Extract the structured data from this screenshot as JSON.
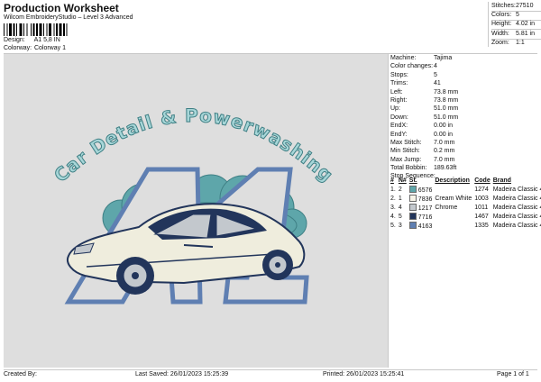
{
  "header": {
    "title": "Production Worksheet",
    "subtitle": "Wilcom EmbroideryStudio – Level 3 Advanced"
  },
  "design": {
    "label": "Design:",
    "value": "A1 5,8 IN"
  },
  "colorway": {
    "label": "Colorway:",
    "value": "Colorway 1"
  },
  "stats": [
    {
      "label": "Stitches:",
      "value": "27510"
    },
    {
      "label": "Colors:",
      "value": "5"
    },
    {
      "label": "Height:",
      "value": "4.02 in"
    },
    {
      "label": "Width:",
      "value": "5.81 in"
    },
    {
      "label": "Zoom:",
      "value": "1:1"
    }
  ],
  "machine_info": [
    {
      "label": "Machine:",
      "value": "Tajima"
    },
    {
      "label": "Color changes:",
      "value": "4"
    },
    {
      "label": "Stops:",
      "value": "5"
    },
    {
      "label": "Trims:",
      "value": "41"
    },
    {
      "label": "Left:",
      "value": "73.8 mm"
    },
    {
      "label": "Right:",
      "value": "73.8 mm"
    },
    {
      "label": "Up:",
      "value": "51.0 mm"
    },
    {
      "label": "Down:",
      "value": "51.0 mm"
    },
    {
      "label": "EndX:",
      "value": "0.00 in"
    },
    {
      "label": "EndY:",
      "value": "0.00 in"
    },
    {
      "label": "Max Stitch:",
      "value": "7.0 mm"
    },
    {
      "label": "Min Stitch:",
      "value": "0.2 mm"
    },
    {
      "label": "Max Jump:",
      "value": "7.0 mm"
    },
    {
      "label": "Total Bobbin:",
      "value": "189.63ft"
    }
  ],
  "stop_sequence": {
    "title": "Stop Sequence:",
    "headers": [
      "#",
      "N#",
      "St.",
      "Description",
      "Code",
      "Brand"
    ],
    "rows": [
      {
        "num": "1.",
        "n": "2",
        "st": "6576",
        "desc": "",
        "code": "1274",
        "brand": "Madeira Classic 40",
        "color": "#5ea6aa"
      },
      {
        "num": "2.",
        "n": "1",
        "st": "7836",
        "desc": "Cream White",
        "code": "1003",
        "brand": "Madeira Classic 40",
        "color": "#f7f4e8"
      },
      {
        "num": "3.",
        "n": "4",
        "st": "1217",
        "desc": "Chrome",
        "code": "1011",
        "brand": "Madeira Classic 40",
        "color": "#c3c8cd"
      },
      {
        "num": "4.",
        "n": "5",
        "st": "7716",
        "desc": "",
        "code": "1467",
        "brand": "Madeira Classic 40",
        "color": "#22355b"
      },
      {
        "num": "5.",
        "n": "3",
        "st": "4163",
        "desc": "",
        "code": "1335",
        "brand": "Madeira Classic 40",
        "color": "#5f7fb2"
      }
    ]
  },
  "artwork": {
    "arc_text": "Car Detail & Powerwashing",
    "logo_text": "A1"
  },
  "footer": {
    "created_by": "Created By:",
    "last_saved": "Last Saved: 26/01/2023 15:25:39",
    "printed": "Printed: 26/01/2023 15:25:41",
    "page": "Page 1 of 1"
  },
  "colors": {
    "canvas_bg": "#dedede",
    "teal": "#5ea6aa",
    "navy": "#22355b",
    "blue": "#5f7fb2"
  }
}
